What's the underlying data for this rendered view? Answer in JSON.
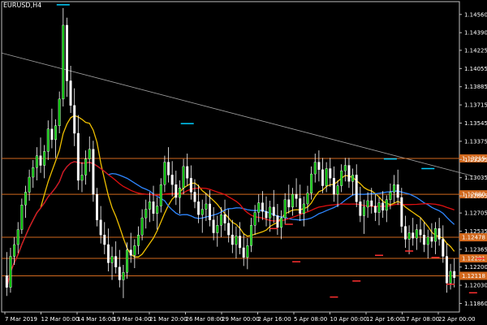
{
  "window": {
    "title": "EURUSD,H4"
  },
  "colors": {
    "background": "#000000",
    "axis": "#c0c0c0",
    "bull": "#00c000",
    "bear": "#ffffff",
    "wick": "#ffffff",
    "ma_fast": "#f0c000",
    "ma_mid": "#2e86ff",
    "ma_slow": "#e01010",
    "hline": "#d2691e",
    "trendline": "#a0a0a0",
    "fractal_up": "#00d0ff",
    "fractal_down": "#ff3030",
    "hline_label_bg": "#d2691e"
  },
  "chart_data": {
    "type": "candlestick",
    "symbol": "EURUSD",
    "timeframe": "H4",
    "price_ticks": [
      "1.14560",
      "1.14390",
      "1.14225",
      "1.14055",
      "1.13885",
      "1.13715",
      "1.13545",
      "1.13375",
      "1.13205",
      "1.13035",
      "1.12865",
      "1.12705",
      "1.12535",
      "1.12365",
      "1.12200",
      "1.12030",
      "1.11860"
    ],
    "time_ticks": [
      "7 Mar 2019",
      "12 Mar 00:00",
      "14 Mar 16:00",
      "19 Mar 04:00",
      "21 Mar 20:00",
      "26 Mar 08:00",
      "29 Mar 00:00",
      "2 Apr 16:00",
      "5 Apr 08:00",
      "10 Apr 00:00",
      "12 Apr 16:00",
      "17 Apr 08:00",
      "22 Apr 00:00"
    ],
    "ylim": [
      1.1178,
      1.1468
    ],
    "horizontal_levels": [
      "1.13215",
      "1.12880",
      "1.12478",
      "1.12281",
      "1.12118"
    ],
    "fractal_up": [
      [
        15,
        1.1462
      ],
      [
        48,
        1.1351
      ],
      [
        102,
        1.1318
      ],
      [
        112,
        1.1309
      ]
    ],
    "fractal_down": [
      [
        71,
        1.1259
      ],
      [
        75,
        1.1263
      ],
      [
        93,
        1.121
      ],
      [
        107,
        1.1238
      ],
      [
        126,
        1.1231
      ],
      [
        124,
        1.1199
      ],
      [
        77,
        1.1228
      ],
      [
        99,
        1.1234
      ],
      [
        87,
        1.1195
      ],
      [
        114,
        1.1232
      ],
      [
        118,
        1.1207
      ]
    ],
    "trendline": [
      [
        0,
        1.142
      ],
      [
        124,
        1.1305
      ]
    ],
    "candles": [
      [
        1.1212,
        1.1234,
        1.1193,
        1.1201
      ],
      [
        1.1201,
        1.1238,
        1.1196,
        1.123
      ],
      [
        1.123,
        1.1248,
        1.1222,
        1.1241
      ],
      [
        1.1241,
        1.1262,
        1.1233,
        1.1255
      ],
      [
        1.1255,
        1.1284,
        1.1251,
        1.1278
      ],
      [
        1.1278,
        1.1296,
        1.1266,
        1.129
      ],
      [
        1.129,
        1.1311,
        1.1282,
        1.1304
      ],
      [
        1.1304,
        1.132,
        1.1294,
        1.1313
      ],
      [
        1.1313,
        1.1332,
        1.1301,
        1.1324
      ],
      [
        1.1324,
        1.1341,
        1.1308,
        1.1315
      ],
      [
        1.1315,
        1.1334,
        1.1303,
        1.1328
      ],
      [
        1.1328,
        1.1357,
        1.132,
        1.1349
      ],
      [
        1.1349,
        1.1368,
        1.1331,
        1.1339
      ],
      [
        1.1339,
        1.1358,
        1.1322,
        1.1352
      ],
      [
        1.1352,
        1.1384,
        1.1345,
        1.1377
      ],
      [
        1.1377,
        1.1462,
        1.137,
        1.1446
      ],
      [
        1.1446,
        1.1453,
        1.1379,
        1.1394
      ],
      [
        1.1394,
        1.1408,
        1.1364,
        1.1371
      ],
      [
        1.1371,
        1.1387,
        1.1333,
        1.1345
      ],
      [
        1.1345,
        1.1362,
        1.1292,
        1.1301
      ],
      [
        1.1301,
        1.1318,
        1.129,
        1.1306
      ],
      [
        1.1306,
        1.1329,
        1.1297,
        1.1321
      ],
      [
        1.1321,
        1.1342,
        1.1309,
        1.133
      ],
      [
        1.133,
        1.1338,
        1.1281,
        1.1288
      ],
      [
        1.1288,
        1.1294,
        1.1258,
        1.1264
      ],
      [
        1.1264,
        1.1277,
        1.1242,
        1.125
      ],
      [
        1.125,
        1.1262,
        1.1232,
        1.1241
      ],
      [
        1.1241,
        1.1256,
        1.1216,
        1.1224
      ],
      [
        1.1224,
        1.1239,
        1.1208,
        1.123
      ],
      [
        1.123,
        1.1244,
        1.1214,
        1.122
      ],
      [
        1.122,
        1.1236,
        1.1201,
        1.1208
      ],
      [
        1.1208,
        1.1222,
        1.1191,
        1.1215
      ],
      [
        1.1215,
        1.1243,
        1.1209,
        1.1236
      ],
      [
        1.1236,
        1.1252,
        1.1224,
        1.1231
      ],
      [
        1.1231,
        1.1246,
        1.1219,
        1.124
      ],
      [
        1.124,
        1.1258,
        1.1232,
        1.125
      ],
      [
        1.125,
        1.1274,
        1.1245,
        1.1266
      ],
      [
        1.1266,
        1.1283,
        1.1256,
        1.1274
      ],
      [
        1.1274,
        1.129,
        1.1262,
        1.1281
      ],
      [
        1.1281,
        1.1296,
        1.1263,
        1.127
      ],
      [
        1.127,
        1.1285,
        1.1255,
        1.1277
      ],
      [
        1.1277,
        1.1303,
        1.1271,
        1.1297
      ],
      [
        1.1297,
        1.1324,
        1.129,
        1.1318
      ],
      [
        1.1318,
        1.1332,
        1.1299,
        1.1306
      ],
      [
        1.1306,
        1.1319,
        1.1286,
        1.1297
      ],
      [
        1.1297,
        1.131,
        1.1278,
        1.1285
      ],
      [
        1.1285,
        1.1301,
        1.127,
        1.1294
      ],
      [
        1.1294,
        1.1321,
        1.1288,
        1.1314
      ],
      [
        1.1314,
        1.1326,
        1.1296,
        1.1303
      ],
      [
        1.1303,
        1.1315,
        1.1283,
        1.129
      ],
      [
        1.129,
        1.1302,
        1.1275,
        1.1281
      ],
      [
        1.1281,
        1.1297,
        1.1261,
        1.1269
      ],
      [
        1.1269,
        1.1283,
        1.1252,
        1.1274
      ],
      [
        1.1274,
        1.1289,
        1.1263,
        1.1279
      ],
      [
        1.1279,
        1.1292,
        1.1258,
        1.1264
      ],
      [
        1.1264,
        1.1276,
        1.1245,
        1.1252
      ],
      [
        1.1252,
        1.1268,
        1.1239,
        1.1259
      ],
      [
        1.1259,
        1.1276,
        1.1248,
        1.1269
      ],
      [
        1.1269,
        1.1283,
        1.1254,
        1.1261
      ],
      [
        1.1261,
        1.1274,
        1.1243,
        1.125
      ],
      [
        1.125,
        1.1264,
        1.1233,
        1.1241
      ],
      [
        1.1241,
        1.1258,
        1.1228,
        1.1249
      ],
      [
        1.1249,
        1.1262,
        1.1232,
        1.1238
      ],
      [
        1.1238,
        1.1251,
        1.1221,
        1.1229
      ],
      [
        1.1229,
        1.1247,
        1.1218,
        1.124
      ],
      [
        1.124,
        1.1266,
        1.1234,
        1.1259
      ],
      [
        1.1259,
        1.1278,
        1.125,
        1.1271
      ],
      [
        1.1271,
        1.1288,
        1.1262,
        1.128
      ],
      [
        1.128,
        1.1291,
        1.1264,
        1.1272
      ],
      [
        1.1272,
        1.1286,
        1.1258,
        1.1266
      ],
      [
        1.1266,
        1.1282,
        1.1253,
        1.1276
      ],
      [
        1.1276,
        1.1292,
        1.1261,
        1.1268
      ],
      [
        1.1268,
        1.1279,
        1.125,
        1.1257
      ],
      [
        1.1257,
        1.1273,
        1.1246,
        1.1266
      ],
      [
        1.1266,
        1.1289,
        1.126,
        1.1283
      ],
      [
        1.1283,
        1.1297,
        1.127,
        1.1276
      ],
      [
        1.1276,
        1.1294,
        1.1268,
        1.1288
      ],
      [
        1.1288,
        1.1303,
        1.1276,
        1.1284
      ],
      [
        1.1284,
        1.1297,
        1.1263,
        1.127
      ],
      [
        1.127,
        1.1286,
        1.1258,
        1.1279
      ],
      [
        1.1279,
        1.1296,
        1.1272,
        1.1289
      ],
      [
        1.1289,
        1.1314,
        1.1283,
        1.1307
      ],
      [
        1.1307,
        1.1326,
        1.1299,
        1.1318
      ],
      [
        1.1318,
        1.1329,
        1.13,
        1.1311
      ],
      [
        1.1311,
        1.1322,
        1.1289,
        1.1296
      ],
      [
        1.1296,
        1.1318,
        1.129,
        1.1312
      ],
      [
        1.1312,
        1.1322,
        1.1295,
        1.1303
      ],
      [
        1.1303,
        1.1314,
        1.1281,
        1.1288
      ],
      [
        1.1288,
        1.1301,
        1.1276,
        1.1296
      ],
      [
        1.1296,
        1.1316,
        1.129,
        1.131
      ],
      [
        1.131,
        1.1322,
        1.13,
        1.1315
      ],
      [
        1.1315,
        1.1322,
        1.1294,
        1.13
      ],
      [
        1.13,
        1.1312,
        1.1287,
        1.1306
      ],
      [
        1.1306,
        1.1316,
        1.1276,
        1.1281
      ],
      [
        1.1281,
        1.1295,
        1.1262,
        1.1268
      ],
      [
        1.1268,
        1.1283,
        1.1251,
        1.1276
      ],
      [
        1.1276,
        1.129,
        1.1266,
        1.1282
      ],
      [
        1.1282,
        1.1294,
        1.127,
        1.1277
      ],
      [
        1.1277,
        1.1288,
        1.1263,
        1.1271
      ],
      [
        1.1271,
        1.1285,
        1.1259,
        1.128
      ],
      [
        1.128,
        1.1291,
        1.1266,
        1.1273
      ],
      [
        1.1273,
        1.1287,
        1.1262,
        1.1283
      ],
      [
        1.1283,
        1.1298,
        1.1274,
        1.129
      ],
      [
        1.129,
        1.1306,
        1.128,
        1.1297
      ],
      [
        1.1297,
        1.1311,
        1.1278,
        1.1285
      ],
      [
        1.1285,
        1.1294,
        1.1252,
        1.1258
      ],
      [
        1.1258,
        1.1268,
        1.1238,
        1.1246
      ],
      [
        1.1246,
        1.1259,
        1.1232,
        1.1252
      ],
      [
        1.1252,
        1.1266,
        1.124,
        1.1247
      ],
      [
        1.1247,
        1.126,
        1.1236,
        1.1255
      ],
      [
        1.1255,
        1.1266,
        1.1243,
        1.125
      ],
      [
        1.125,
        1.1262,
        1.1234,
        1.1241
      ],
      [
        1.1241,
        1.1255,
        1.1228,
        1.1248
      ],
      [
        1.1248,
        1.1261,
        1.1238,
        1.1244
      ],
      [
        1.1244,
        1.1262,
        1.1232,
        1.1256
      ],
      [
        1.1256,
        1.1266,
        1.124,
        1.1246
      ],
      [
        1.1246,
        1.1259,
        1.1224,
        1.123
      ],
      [
        1.123,
        1.1242,
        1.1196,
        1.1205
      ],
      [
        1.1205,
        1.1223,
        1.1199,
        1.1216
      ],
      [
        1.1216,
        1.1228,
        1.1201,
        1.121
      ]
    ]
  }
}
